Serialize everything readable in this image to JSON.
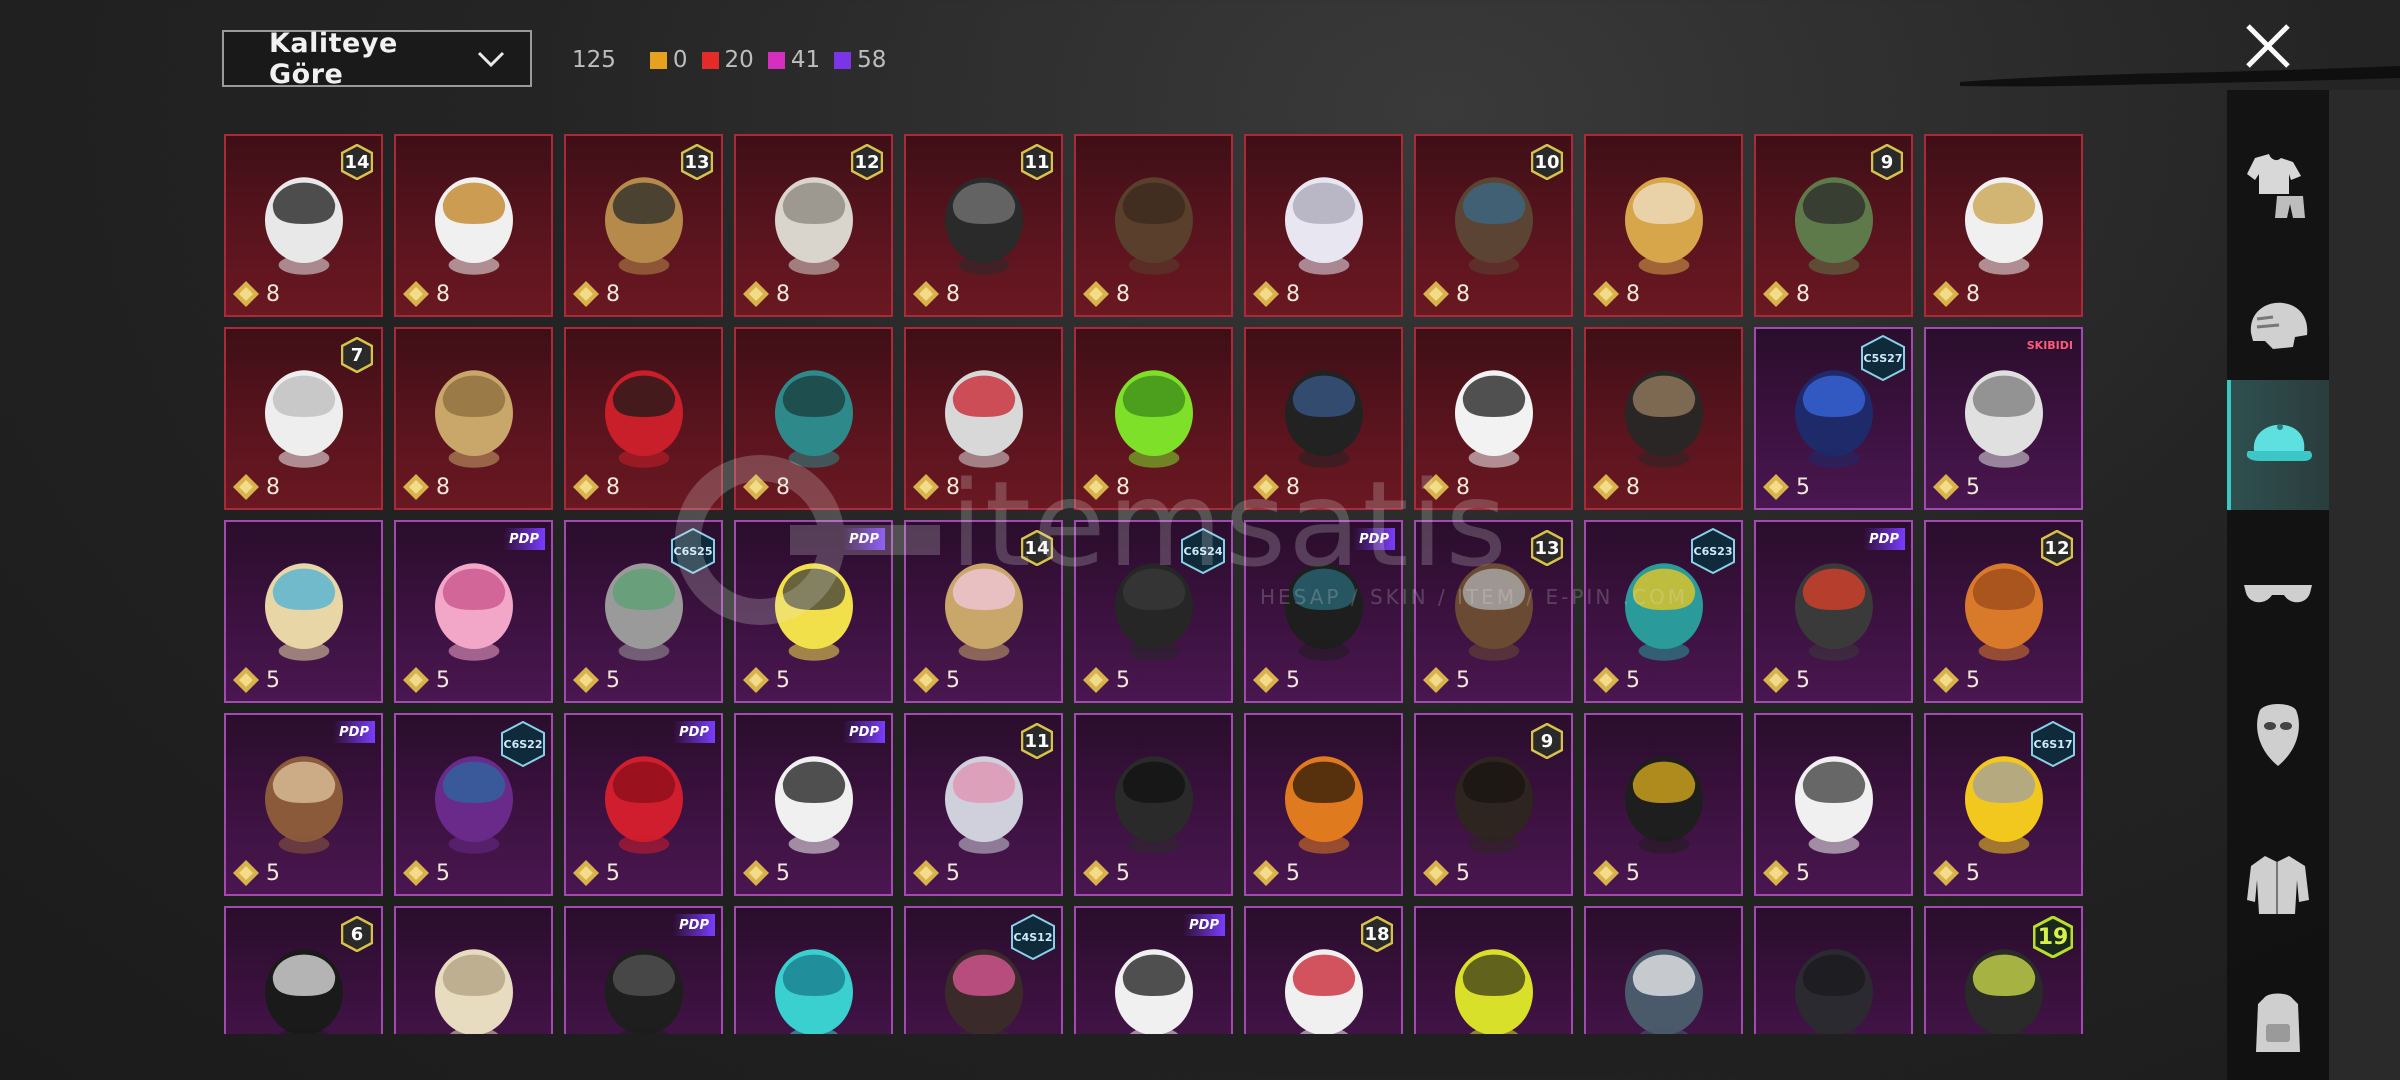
{
  "header": {
    "sort_label": "Kaliteye Göre",
    "total_count": "125",
    "rarity_counts": [
      {
        "color": "#e6a21e",
        "value": "0"
      },
      {
        "color": "#e52a2a",
        "value": "20"
      },
      {
        "color": "#d62fc0",
        "value": "41"
      },
      {
        "color": "#7a35e8",
        "value": "58"
      }
    ]
  },
  "watermark": {
    "text": "itemsatis",
    "subtext": "HESAP / SKIN / ITEM / E-PIN .COM"
  },
  "sidebar": {
    "tabs": [
      "outfit-icon",
      "helmet-icon",
      "cap-icon",
      "glasses-icon",
      "mask-icon",
      "jacket-icon",
      "backpack-icon"
    ],
    "active_index": 2
  },
  "items": [
    {
      "rarity": "red",
      "art": "cat-mask-hair",
      "badge": {
        "type": "num",
        "value": "14"
      },
      "price": "8"
    },
    {
      "rarity": "red",
      "art": "horned-white-hair",
      "price": "8"
    },
    {
      "rarity": "red",
      "art": "hat-blonde-hair",
      "badge": {
        "type": "num",
        "value": "13"
      },
      "price": "8"
    },
    {
      "rarity": "red",
      "art": "bunny-white-hair",
      "badge": {
        "type": "num",
        "value": "12"
      },
      "price": "8"
    },
    {
      "rarity": "red",
      "art": "black-helmet",
      "badge": {
        "type": "num",
        "value": "11"
      },
      "price": "8"
    },
    {
      "rarity": "red",
      "art": "brown-short-hair",
      "price": "8"
    },
    {
      "rarity": "red",
      "art": "silver-long-hair",
      "price": "8"
    },
    {
      "rarity": "red",
      "art": "brown-braided-hair",
      "badge": {
        "type": "num",
        "value": "10"
      },
      "price": "8"
    },
    {
      "rarity": "red",
      "art": "skull-blonde",
      "price": "8"
    },
    {
      "rarity": "red",
      "art": "zombie-head",
      "badge": {
        "type": "num",
        "value": "9"
      },
      "price": "8"
    },
    {
      "rarity": "red",
      "art": "white-cowboy-hat",
      "price": "8"
    },
    {
      "rarity": "red",
      "art": "white-ponytail",
      "badge": {
        "type": "num",
        "value": "7"
      },
      "price": "8"
    },
    {
      "rarity": "red",
      "art": "blonde-wavy-hair",
      "price": "8"
    },
    {
      "rarity": "red",
      "art": "red-helmet",
      "price": "8"
    },
    {
      "rarity": "red",
      "art": "teal-spike-helmet",
      "price": "8"
    },
    {
      "rarity": "red",
      "art": "red-oni-mask",
      "price": "8"
    },
    {
      "rarity": "red",
      "art": "green-spiky-head",
      "price": "8"
    },
    {
      "rarity": "red",
      "art": "black-cap-mask",
      "price": "8"
    },
    {
      "rarity": "red",
      "art": "ghost-sheet",
      "price": "8"
    },
    {
      "rarity": "red",
      "art": "pirate-hat",
      "price": "8"
    },
    {
      "rarity": "purple",
      "art": "blue-bunny-helmet",
      "badge": {
        "type": "season",
        "value": "C5S27"
      },
      "price": "5"
    },
    {
      "rarity": "purple",
      "art": "camera-head",
      "badge": {
        "type": "text",
        "value": "SKIBIDI"
      },
      "price": "5"
    },
    {
      "rarity": "purple",
      "art": "blonde-pigtails",
      "price": "5"
    },
    {
      "rarity": "purple",
      "art": "pink-bow-headband",
      "badge": {
        "type": "pdp",
        "value": "PDP"
      },
      "price": "5"
    },
    {
      "rarity": "purple",
      "art": "grey-messy-hair",
      "badge": {
        "type": "season",
        "value": "C6S25"
      },
      "price": "5"
    },
    {
      "rarity": "purple",
      "art": "yellow-box-head",
      "badge": {
        "type": "pdp",
        "value": "PDP"
      },
      "price": "5"
    },
    {
      "rarity": "purple",
      "art": "flower-blonde-hair",
      "badge": {
        "type": "num",
        "value": "14"
      },
      "price": "5"
    },
    {
      "rarity": "purple",
      "art": "black-short-hair",
      "badge": {
        "type": "season",
        "value": "C6S24"
      },
      "price": "5"
    },
    {
      "rarity": "purple",
      "art": "black-tousled-hair",
      "badge": {
        "type": "pdp",
        "value": "PDP"
      },
      "price": "5"
    },
    {
      "rarity": "purple",
      "art": "goggle-brown-hair",
      "badge": {
        "type": "num",
        "value": "13"
      },
      "price": "5"
    },
    {
      "rarity": "purple",
      "art": "yellow-headphones",
      "badge": {
        "type": "season",
        "value": "C6S23"
      },
      "price": "5"
    },
    {
      "rarity": "purple",
      "art": "red-visor-cap",
      "badge": {
        "type": "pdp",
        "value": "PDP"
      },
      "price": "5"
    },
    {
      "rarity": "purple",
      "art": "orange-long-hair",
      "badge": {
        "type": "num",
        "value": "12"
      },
      "price": "5"
    },
    {
      "rarity": "purple",
      "art": "horned-beast-head",
      "badge": {
        "type": "pdp",
        "value": "PDP"
      },
      "price": "5"
    },
    {
      "rarity": "purple",
      "art": "purple-bob-hair",
      "badge": {
        "type": "season",
        "value": "C6S22"
      },
      "price": "5"
    },
    {
      "rarity": "purple",
      "art": "red-bob-hair",
      "badge": {
        "type": "pdp",
        "value": "PDP"
      },
      "price": "5"
    },
    {
      "rarity": "purple",
      "art": "panda-head",
      "badge": {
        "type": "pdp",
        "value": "PDP"
      },
      "price": "5"
    },
    {
      "rarity": "purple",
      "art": "floral-grey-hair",
      "badge": {
        "type": "num",
        "value": "11"
      },
      "price": "5"
    },
    {
      "rarity": "purple",
      "art": "black-balaclava",
      "price": "5"
    },
    {
      "rarity": "purple",
      "art": "pumpkin-head",
      "price": "5"
    },
    {
      "rarity": "purple",
      "art": "dark-ponytail",
      "badge": {
        "type": "num",
        "value": "9"
      },
      "price": "5"
    },
    {
      "rarity": "purple",
      "art": "police-caps",
      "price": "5"
    },
    {
      "rarity": "purple",
      "art": "white-feather-hair",
      "price": "5"
    },
    {
      "rarity": "purple",
      "art": "yellow-visor",
      "badge": {
        "type": "season",
        "value": "C6S17"
      },
      "price": "5"
    },
    {
      "rarity": "purple",
      "art": "dark-mask-white",
      "badge": {
        "type": "num",
        "value": "6"
      },
      "price": ""
    },
    {
      "rarity": "purple",
      "art": "cream-curly-hair",
      "price": ""
    },
    {
      "rarity": "purple",
      "art": "black-cat-head",
      "badge": {
        "type": "pdp",
        "value": "PDP"
      },
      "price": ""
    },
    {
      "rarity": "purple",
      "art": "teal-feathers",
      "price": ""
    },
    {
      "rarity": "purple",
      "art": "pink-headband-hair",
      "badge": {
        "type": "season",
        "value": "C4S12"
      },
      "price": ""
    },
    {
      "rarity": "purple",
      "art": "white-bunny-ears",
      "badge": {
        "type": "pdp",
        "value": "PDP"
      },
      "price": ""
    },
    {
      "rarity": "purple",
      "art": "uncle-sam-hat",
      "badge": {
        "type": "num",
        "value": "18"
      },
      "price": ""
    },
    {
      "rarity": "purple",
      "art": "yellow-bucket-hat",
      "price": ""
    },
    {
      "rarity": "purple",
      "art": "shark-head",
      "price": ""
    },
    {
      "rarity": "purple",
      "art": "dark-round-mask",
      "price": ""
    },
    {
      "rarity": "purple",
      "art": "goggle-creature",
      "badge": {
        "type": "big",
        "value": "19"
      },
      "price": ""
    }
  ]
}
